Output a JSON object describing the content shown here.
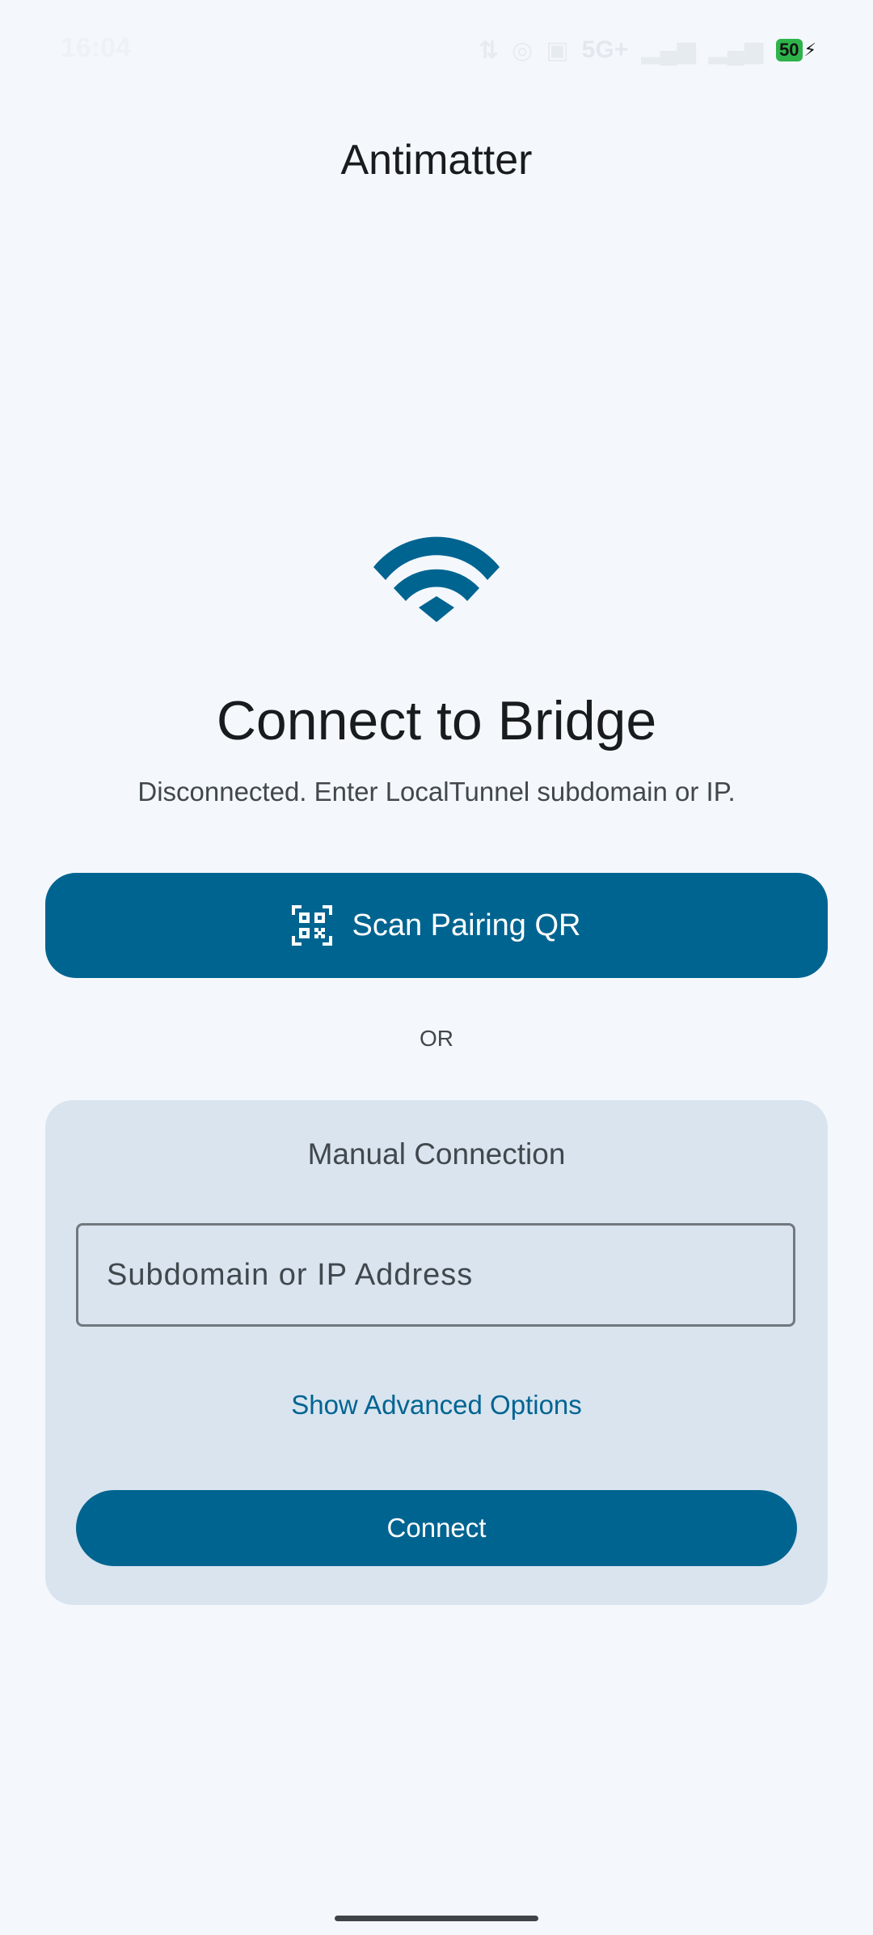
{
  "status_bar": {
    "time": "16:04",
    "network": "5G+",
    "battery": "50"
  },
  "app": {
    "title": "Antimatter"
  },
  "main": {
    "icon": "wifi-icon",
    "heading": "Connect to Bridge",
    "status": "Disconnected. Enter LocalTunnel subdomain or IP.",
    "scan_button_label": "Scan Pairing QR",
    "scan_button_icon": "qr-code-scanner-icon",
    "or_label": "OR"
  },
  "manual": {
    "title": "Manual Connection",
    "input_placeholder": "Subdomain or IP Address",
    "input_value": "",
    "advanced_label": "Show Advanced Options",
    "connect_label": "Connect"
  },
  "colors": {
    "primary": "#006491",
    "background": "#f4f8fc",
    "card": "#d9e4ef",
    "battery": "#2eb34a"
  }
}
